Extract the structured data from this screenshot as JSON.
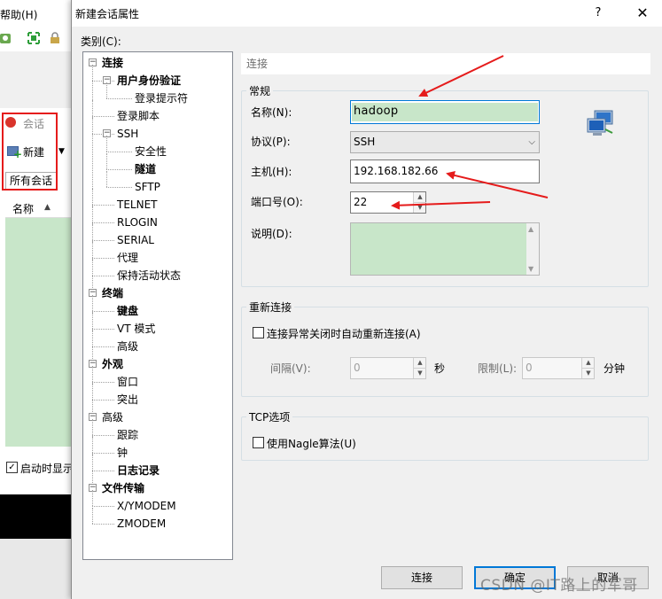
{
  "background_app": {
    "menu_help": "帮助(H)",
    "session_panel_title": "会话",
    "new_button": "新建",
    "all_sessions": "所有会话",
    "list_header_name": "名称",
    "show_on_startup": "启动时显示"
  },
  "dialog": {
    "title": "新建会话属性",
    "help_button": "?",
    "close_button": "✕",
    "category_label": "类别(C):",
    "tree": [
      {
        "label": "连接",
        "level": 0,
        "bold": true,
        "expanded": true
      },
      {
        "label": "用户身份验证",
        "level": 1,
        "bold": true,
        "expanded": true
      },
      {
        "label": "登录提示符",
        "level": 2,
        "bold": false
      },
      {
        "label": "登录脚本",
        "level": 1,
        "bold": false
      },
      {
        "label": "SSH",
        "level": 1,
        "bold": false,
        "expanded": true
      },
      {
        "label": "安全性",
        "level": 2,
        "bold": false
      },
      {
        "label": "隧道",
        "level": 2,
        "bold": true
      },
      {
        "label": "SFTP",
        "level": 2,
        "bold": false
      },
      {
        "label": "TELNET",
        "level": 1,
        "bold": false
      },
      {
        "label": "RLOGIN",
        "level": 1,
        "bold": false
      },
      {
        "label": "SERIAL",
        "level": 1,
        "bold": false
      },
      {
        "label": "代理",
        "level": 1,
        "bold": false
      },
      {
        "label": "保持活动状态",
        "level": 1,
        "bold": false
      },
      {
        "label": "终端",
        "level": 0,
        "bold": true,
        "expanded": true
      },
      {
        "label": "键盘",
        "level": 1,
        "bold": true
      },
      {
        "label": "VT 模式",
        "level": 1,
        "bold": false
      },
      {
        "label": "高级",
        "level": 1,
        "bold": false
      },
      {
        "label": "外观",
        "level": 0,
        "bold": true,
        "expanded": true
      },
      {
        "label": "窗口",
        "level": 1,
        "bold": false
      },
      {
        "label": "突出",
        "level": 1,
        "bold": false
      },
      {
        "label": "高级",
        "level": 0,
        "bold": false,
        "expanded": true
      },
      {
        "label": "跟踪",
        "level": 1,
        "bold": false
      },
      {
        "label": "钟",
        "level": 1,
        "bold": false
      },
      {
        "label": "日志记录",
        "level": 1,
        "bold": true
      },
      {
        "label": "文件传输",
        "level": 0,
        "bold": true,
        "expanded": true
      },
      {
        "label": "X/YMODEM",
        "level": 1,
        "bold": false
      },
      {
        "label": "ZMODEM",
        "level": 1,
        "bold": false
      }
    ],
    "section_header": "连接",
    "general": {
      "title": "常规",
      "name_label": "名称(N):",
      "name_value": "hadoop",
      "protocol_label": "协议(P):",
      "protocol_value": "SSH",
      "host_label": "主机(H):",
      "host_value": "192.168.182.66",
      "port_label": "端口号(O):",
      "port_value": "22",
      "description_label": "说明(D):",
      "description_value": ""
    },
    "reconnect": {
      "title": "重新连接",
      "auto_reconnect_label": "连接异常关闭时自动重新连接(A)",
      "auto_reconnect_checked": false,
      "interval_label": "间隔(V):",
      "interval_value": "0",
      "interval_unit": "秒",
      "limit_label": "限制(L):",
      "limit_value": "0",
      "limit_unit": "分钟"
    },
    "tcp": {
      "title": "TCP选项",
      "nagle_label": "使用Nagle算法(U)",
      "nagle_checked": false
    },
    "buttons": {
      "connect": "连接",
      "ok": "确定",
      "cancel": "取消"
    }
  },
  "watermark": "CSDN @IT路上的军哥",
  "colors": {
    "annotation_red": "#e51b1b",
    "field_green": "#c8e6c9",
    "focus_blue": "#0078d7"
  }
}
